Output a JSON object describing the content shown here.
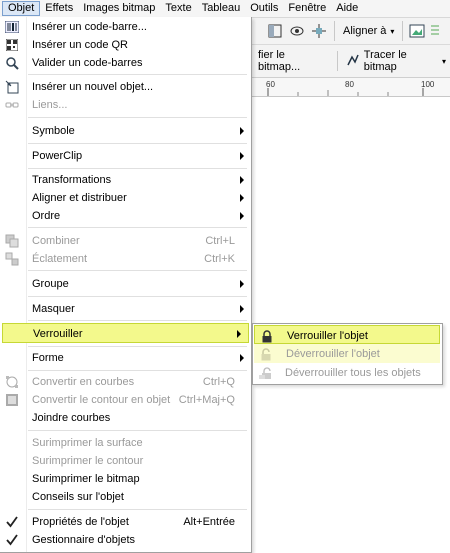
{
  "menubar": {
    "items": [
      "Objet",
      "Effets",
      "Images bitmap",
      "Texte",
      "Tableau",
      "Outils",
      "Fenêtre",
      "Aide"
    ],
    "active_index": 0
  },
  "toolbar": {
    "align_label": "Aligner à",
    "bitmap_label": "fier le bitmap...",
    "trace_label": "Tracer le bitmap"
  },
  "ruler": {
    "labels": [
      "60",
      "80",
      "100"
    ]
  },
  "menu": {
    "items": [
      {
        "label": "Insérer un code-barre...",
        "icon": "barcode-icon",
        "enabled": true
      },
      {
        "label": "Insérer un code QR",
        "icon": "qr-code-icon",
        "enabled": true
      },
      {
        "label": "Valider un code-barres",
        "icon": "validate-barcode-icon",
        "enabled": true
      },
      {
        "label": "Insérer un nouvel objet...",
        "icon": "insert-object-icon",
        "enabled": true
      },
      {
        "label": "Liens...",
        "icon": "links-icon",
        "enabled": false
      },
      {
        "label": "Symbole",
        "enabled": true,
        "submenu": true
      },
      {
        "label": "PowerClip",
        "enabled": true,
        "submenu": true
      },
      {
        "label": "Transformations",
        "enabled": true,
        "submenu": true
      },
      {
        "label": "Aligner et distribuer",
        "enabled": true,
        "submenu": true
      },
      {
        "label": "Ordre",
        "enabled": true,
        "submenu": true
      },
      {
        "label": "Combiner",
        "icon": "combine-icon",
        "enabled": false,
        "shortcut": "Ctrl+L"
      },
      {
        "label": "Éclatement",
        "icon": "break-apart-icon",
        "enabled": false,
        "shortcut": "Ctrl+K"
      },
      {
        "label": "Groupe",
        "enabled": true,
        "submenu": true
      },
      {
        "label": "Masquer",
        "enabled": true,
        "submenu": true
      },
      {
        "label": "Verrouiller",
        "enabled": true,
        "submenu": true,
        "highlighted": true
      },
      {
        "label": "Forme",
        "enabled": true,
        "submenu": true
      },
      {
        "label": "Convertir en courbes",
        "icon": "convert-curves-icon",
        "enabled": false,
        "shortcut": "Ctrl+Q"
      },
      {
        "label": "Convertir le contour en objet",
        "icon": "outline-to-object-icon",
        "enabled": false,
        "shortcut": "Ctrl+Maj+Q"
      },
      {
        "label": "Joindre courbes",
        "enabled": true
      },
      {
        "label": "Surimprimer la surface",
        "enabled": false
      },
      {
        "label": "Surimprimer le contour",
        "enabled": false
      },
      {
        "label": "Surimprimer le bitmap",
        "enabled": true
      },
      {
        "label": "Conseils sur l'objet",
        "enabled": true
      },
      {
        "label": "Propriétés de l'objet",
        "icon": "check-icon",
        "enabled": true,
        "shortcut": "Alt+Entrée"
      },
      {
        "label": "Gestionnaire d'objets",
        "icon": "check-icon",
        "enabled": true
      }
    ]
  },
  "submenu": {
    "items": [
      {
        "label": "Verrouiller l'objet",
        "icon": "lock-icon",
        "enabled": true
      },
      {
        "label": "Déverrouiller l'objet",
        "icon": "unlock-icon",
        "enabled": false
      },
      {
        "label": "Déverrouiller tous les objets",
        "icon": "unlock-all-icon",
        "enabled": false
      }
    ]
  },
  "colors": {
    "highlight_fill": "#f3f98c",
    "highlight_border": "#c6d835",
    "disabled_text": "#9a9a9a"
  }
}
